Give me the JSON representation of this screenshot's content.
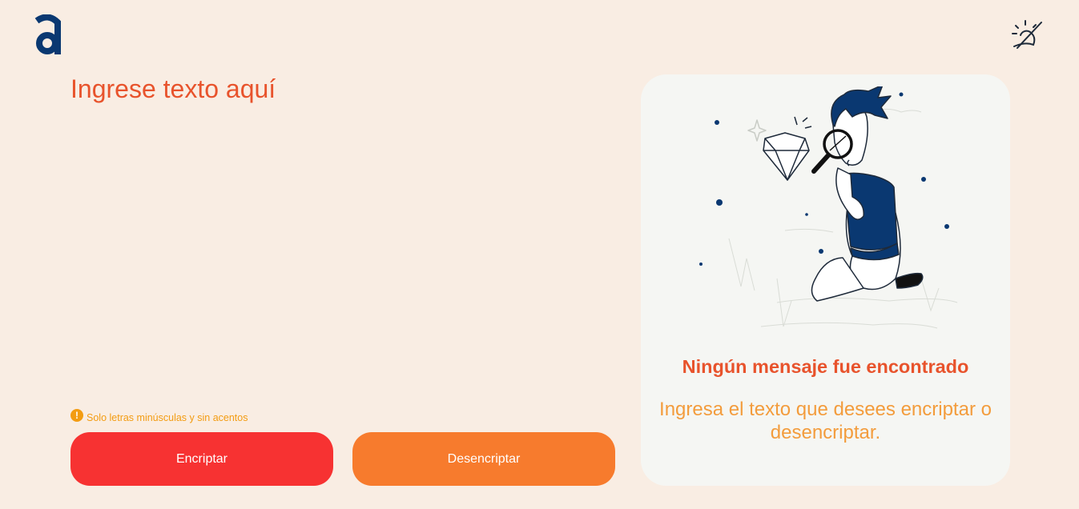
{
  "header": {
    "logo_icon": "letter-a-logo",
    "theme_toggle_icon": "sun-moon-icon"
  },
  "input": {
    "placeholder": "Ingrese texto aquí",
    "value": ""
  },
  "hint": {
    "icon": "warning-icon",
    "icon_glyph": "!",
    "text": "Solo letras minúsculas y sin acentos"
  },
  "buttons": {
    "encrypt_label": "Encriptar",
    "decrypt_label": "Desencriptar"
  },
  "output": {
    "illustration": "person-with-magnifying-glass-illustration",
    "title": "Ningún mensaje fue encontrado",
    "description": "Ingresa el texto que desees encriptar o desencriptar."
  },
  "colors": {
    "background": "#f9ede3",
    "brand_blue": "#0a3871",
    "accent_text": "#e8532c",
    "encrypt_button": "#f73232",
    "decrypt_button": "#f77b2d",
    "hint": "#f39c12",
    "panel": "#f5f6f3"
  }
}
